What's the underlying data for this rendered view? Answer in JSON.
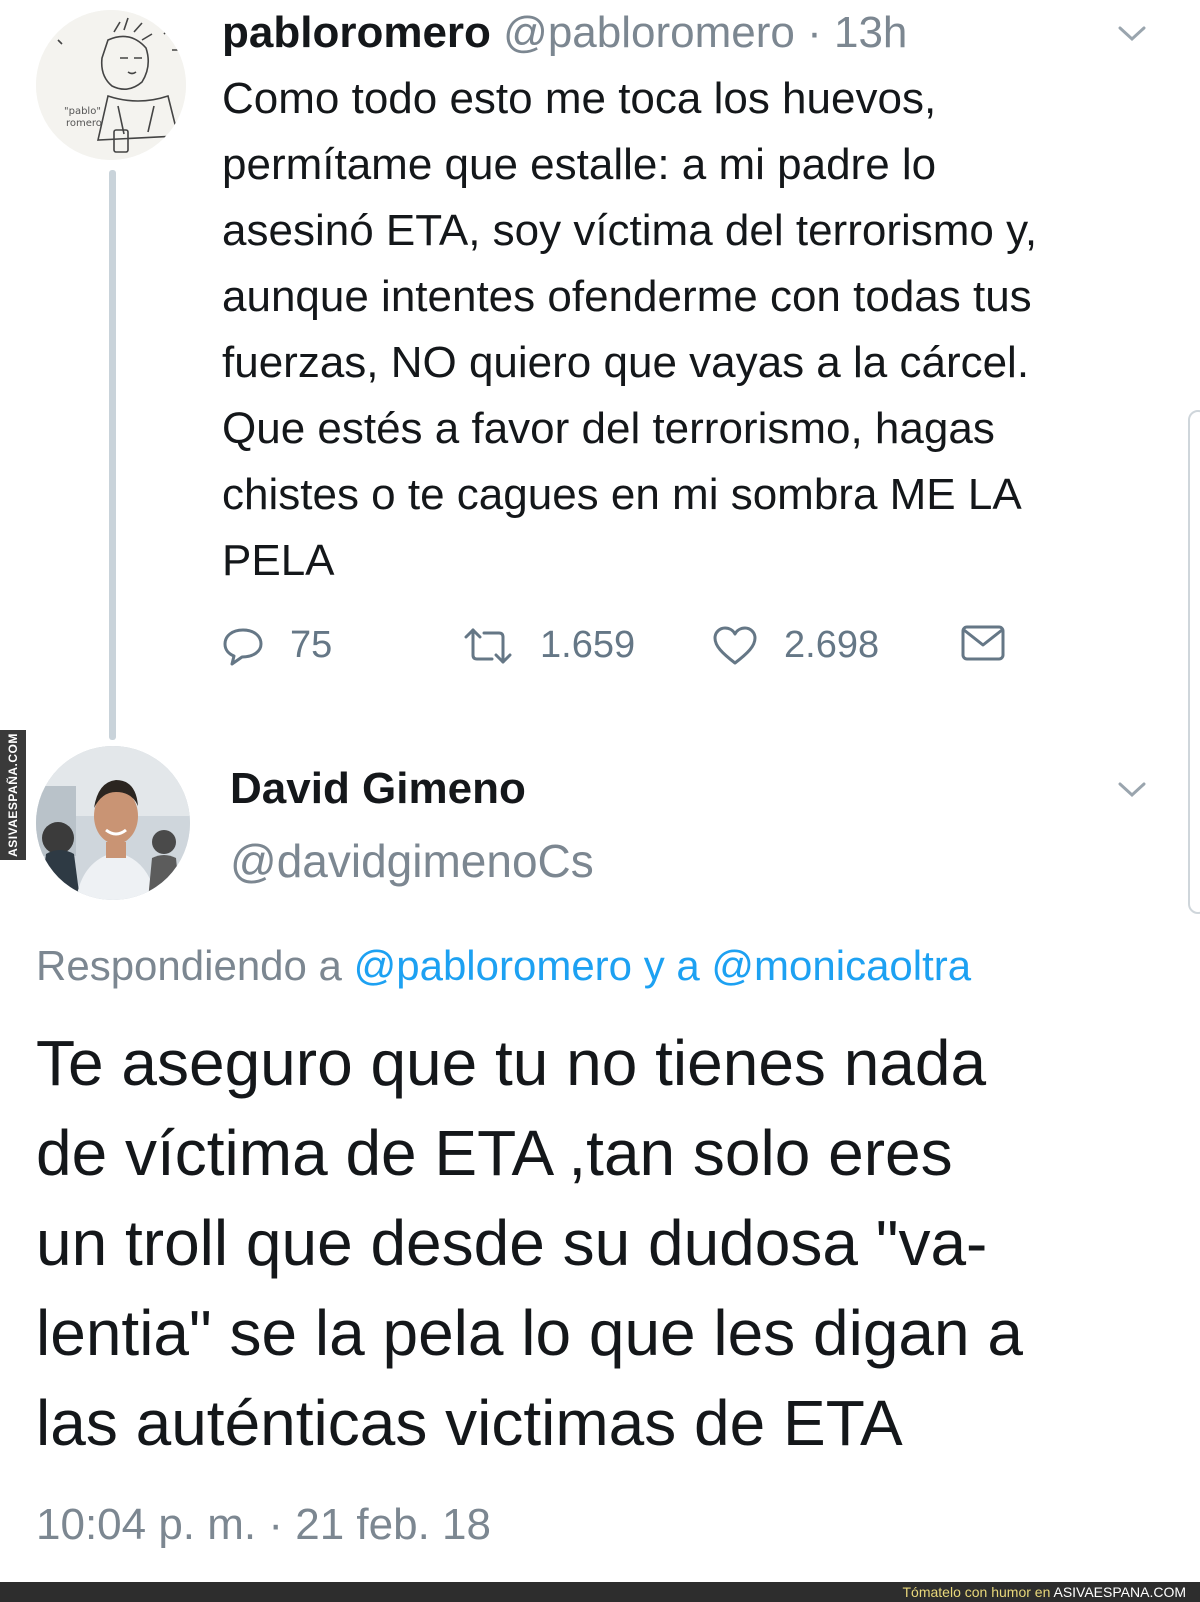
{
  "tweet1": {
    "name": "pabloromero",
    "handle": "@pabloromero",
    "separator": "·",
    "time": "13h",
    "text": "Como todo esto me toca los huevos,\npermítame que estalle: a mi padre lo\nasesinó ETA, soy víctima del terrorismo y,\naunque intentes ofenderme con todas tus\nfuerzas, NO quiero que vayas a la cárcel.\nQue estés a favor del terrorismo, hagas\nchistes o te cagues en mi sombra ME LA\nPELA",
    "replies": "75",
    "retweets": "1.659",
    "likes": "2.698",
    "avatar_caption": "pablo romero"
  },
  "tweet2": {
    "name": "David Gimeno",
    "handle": "@davidgimenoCs",
    "reply_prefix": "Respondiendo a",
    "reply_mention1": "@pabloromero",
    "reply_and": "y a",
    "reply_mention2": "@monicaoltra",
    "text": "Te aseguro que tu no tienes nada\nde víctima de ETA ,tan solo eres\nun troll que desde su dudosa \"va-\nlentia\" se la pela lo que les digan a\nlas auténticas victimas de ETA",
    "timestamp": "10:04 p. m. · 21 feb. 18"
  },
  "side_brand": "ASIVAESPAÑA.COM",
  "footer": {
    "prefix": "Tómatelo con humor en",
    "brand": "ASIVAESPANA.COM"
  },
  "colors": {
    "accent": "#1da1f2",
    "muted": "#7c8791",
    "text": "#14171a"
  },
  "icons": [
    "reply-icon",
    "retweet-icon",
    "like-icon",
    "message-icon",
    "chevron-down-icon"
  ]
}
